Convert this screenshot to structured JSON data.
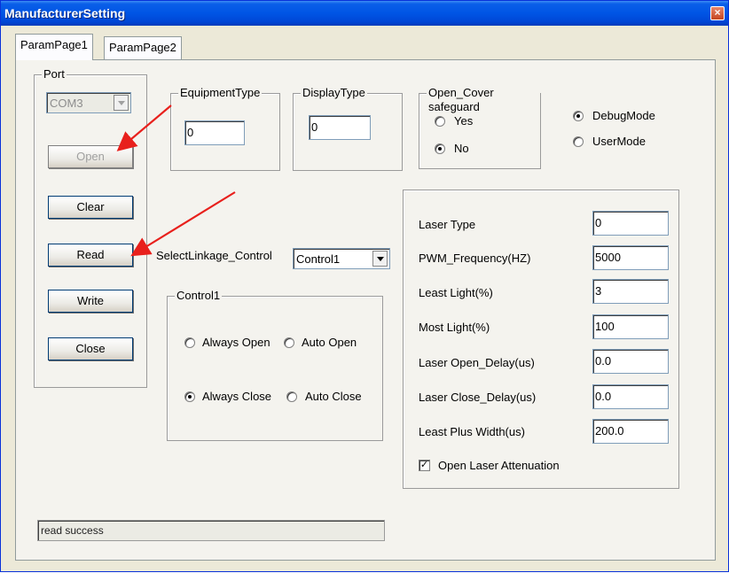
{
  "window": {
    "title": "ManufacturerSetting",
    "close_glyph": "×"
  },
  "tabs": [
    {
      "label": "ParamPage1",
      "active": true
    },
    {
      "label": "ParamPage2",
      "active": false
    }
  ],
  "port": {
    "legend": "Port",
    "com_value": "COM3",
    "buttons": {
      "open": "Open",
      "clear": "Clear",
      "read": "Read",
      "write": "Write",
      "close": "Close"
    }
  },
  "equipment_type": {
    "legend": "EquipmentType",
    "value": "0"
  },
  "display_type": {
    "legend": "DisplayType",
    "value": "0"
  },
  "open_cover": {
    "legend": "Open_Cover safeguard",
    "yes": "Yes",
    "no": "No",
    "selected": "No"
  },
  "mode": {
    "debug": "DebugMode",
    "user": "UserMode",
    "selected": "DebugMode"
  },
  "linkage": {
    "label": "SelectLinkage_Control",
    "value": "Control1"
  },
  "control1": {
    "legend": "Control1",
    "always_open": "Always Open",
    "auto_open": "Auto Open",
    "always_close": "Always Close",
    "auto_close": "Auto Close",
    "selected": "Always Close"
  },
  "laser": {
    "params": [
      {
        "label": "Laser Type",
        "value": "0"
      },
      {
        "label": "PWM_Frequency(HZ)",
        "value": "5000"
      },
      {
        "label": "Least Light(%)",
        "value": "3"
      },
      {
        "label": "Most Light(%)",
        "value": "100"
      },
      {
        "label": "Laser Open_Delay(us)",
        "value": "0.0"
      },
      {
        "label": "Laser Close_Delay(us)",
        "value": "0.0"
      },
      {
        "label": "Least Plus Width(us)",
        "value": "200.0"
      }
    ],
    "attenuation_label": "Open Laser Attenuation",
    "attenuation_checked": true
  },
  "status_text": "read success",
  "colors": {
    "annotation_arrow": "#e8201c",
    "title_bar": "#0055e5"
  }
}
